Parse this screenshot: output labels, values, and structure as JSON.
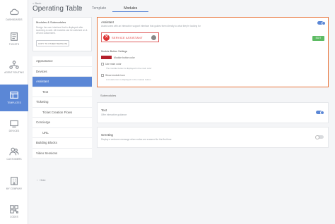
{
  "nav": [
    {
      "label": "Dashboards",
      "icon": "cloud-icon"
    },
    {
      "label": "Tickets",
      "icon": "ticket-icon"
    },
    {
      "label": "Agent Routing",
      "icon": "routing-icon"
    },
    {
      "label": "Templates",
      "icon": "template-icon",
      "active": true
    },
    {
      "label": "Devices",
      "icon": "devices-icon"
    },
    {
      "label": "Customers",
      "icon": "customers-icon"
    },
    {
      "label": "My Company",
      "icon": "company-icon"
    },
    {
      "label": "Codes",
      "icon": "codes-icon"
    }
  ],
  "header": {
    "back": "< Back",
    "title": "Operating Table",
    "info": "i",
    "tabs": [
      {
        "label": "Template"
      },
      {
        "label": "Modules",
        "active": true
      }
    ]
  },
  "panel": {
    "title": "Modules & Submodules",
    "desc": "Design the user interface that is displayed after scanning a code. All modules can be switched on & off and customized.",
    "copy": "COPY TO OTHER TEMPLATE"
  },
  "menu": [
    {
      "label": "Appearance"
    },
    {
      "label": "Devices"
    },
    {
      "label": "Assistant",
      "active": true
    },
    {
      "label": "Text",
      "sub": true
    },
    {
      "label": "Ticketing"
    },
    {
      "label": "Ticket Creation Flows",
      "sub": true
    },
    {
      "label": "Concierge"
    },
    {
      "label": "URL",
      "sub": true
    },
    {
      "label": "Building Blocks"
    },
    {
      "label": "Video Sessions"
    }
  ],
  "hide": "Hide",
  "assistant": {
    "title": "Assistant",
    "desc": "Assist users with an interactive support interface that guides them directly to what they're looking for",
    "preview_text": "SERVICE ASSISTANT",
    "edit": "EDIT",
    "settings_title": "Module Button Settings",
    "color_label": "Module button color",
    "button_color": "#b51f2a",
    "main_color_label": "Use main color",
    "main_color_desc": "The module button is displayed in the main color",
    "show_icon_label": "Show module icon",
    "show_icon_desc": "A module icon is displayed in the module button",
    "enabled": true
  },
  "submodules_title": "Submodules",
  "submodules": [
    {
      "title": "Text",
      "desc": "Offer interactive guidance",
      "enabled": true
    },
    {
      "title": "Greeting",
      "desc": "Display a welcome message when codes are scanned for the first time",
      "enabled": false
    }
  ],
  "colors": {
    "accent": "#5b87d6",
    "highlight": "#e8743a",
    "edit": "#5dbb63"
  }
}
